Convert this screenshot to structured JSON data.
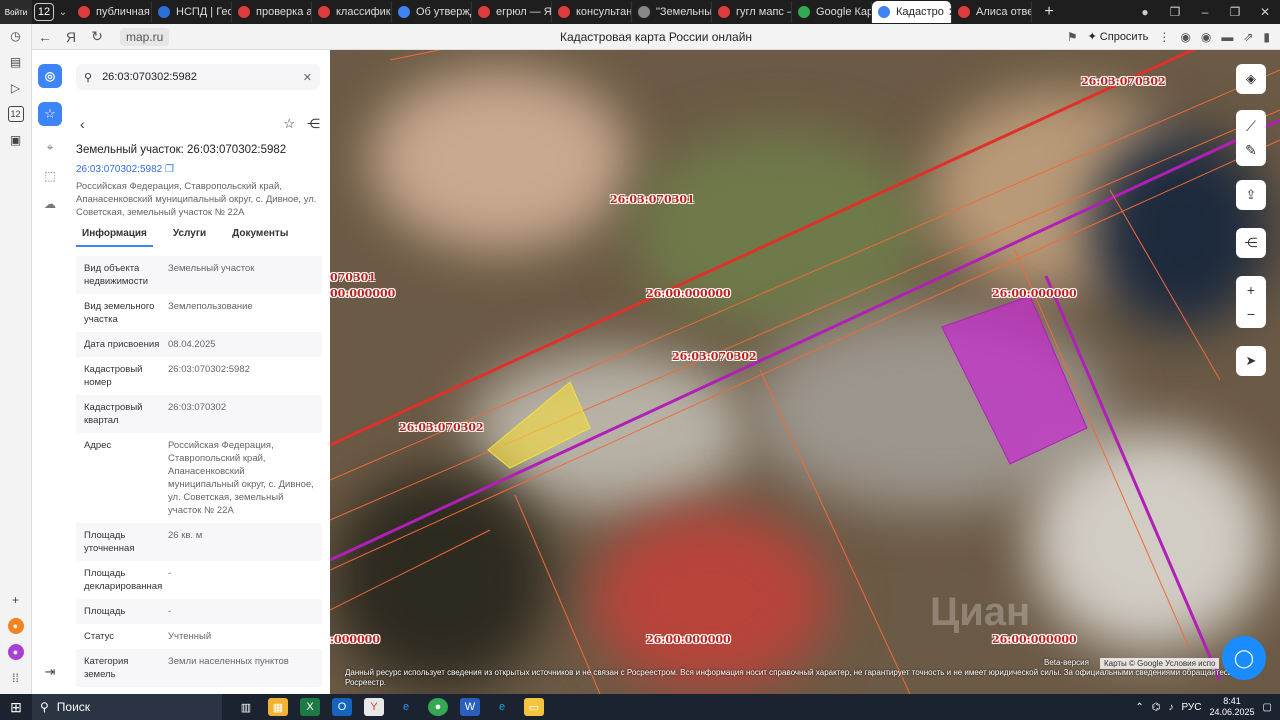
{
  "browser": {
    "tab_count": "12",
    "tabs": [
      {
        "label": "публичная к",
        "color": "#e23b3b"
      },
      {
        "label": "НСПД | Геоп",
        "color": "#2a6fdb"
      },
      {
        "label": "проверка ав",
        "color": "#e23b3b"
      },
      {
        "label": "классифика",
        "color": "#e23b3b"
      },
      {
        "label": "Об утвержд",
        "color": "#3c84f7"
      },
      {
        "label": "егрюл — Янд",
        "color": "#e23b3b"
      },
      {
        "label": "консультант",
        "color": "#e23b3b"
      },
      {
        "label": "\"Земельный",
        "color": "#888888"
      },
      {
        "label": "гугл мапс —",
        "color": "#e23b3b"
      },
      {
        "label": "Google Карт",
        "color": "#34a853"
      },
      {
        "label": "Кадастро",
        "color": "#3c84f7"
      },
      {
        "label": "Алиса отвеч",
        "color": "#e23b3b"
      }
    ],
    "url": "map.ru",
    "page_title": "Кадастровая карта России онлайн",
    "ask_label": "Спросить"
  },
  "os_sidebar": {
    "badge": "12",
    "login": "Войти"
  },
  "panel": {
    "search_value": "26:03:070302:5982",
    "title": "Земельный участок: 26:03:070302:5982",
    "link": "26:03:070302:5982",
    "address": "Российская Федерация, Ставропольский край, Апанасенковский муниципальный округ, с. Дивное, ул. Советская, земельный участок № 22А",
    "tabs": [
      "Информация",
      "Услуги",
      "Документы"
    ],
    "rows": [
      {
        "k": "Вид объекта недвижимости",
        "v": "Земельный участок"
      },
      {
        "k": "Вид земельного участка",
        "v": "Землепользование"
      },
      {
        "k": "Дата присвоения",
        "v": "08.04.2025"
      },
      {
        "k": "Кадастровый номер",
        "v": "26:03:070302:5982"
      },
      {
        "k": "Кадастровый квартал",
        "v": "26:03:070302"
      },
      {
        "k": "Адрес",
        "v": "Российская Федерация, Ставропольский край, Апанасенковский муниципальный округ, с. Дивное, ул. Советская, земельный участок № 22А"
      },
      {
        "k": "Площадь уточненная",
        "v": "26 кв. м"
      },
      {
        "k": "Площадь декларированная",
        "v": "-"
      },
      {
        "k": "Площадь",
        "v": "-"
      },
      {
        "k": "Статус",
        "v": "Учтенный"
      },
      {
        "k": "Категория земель",
        "v": "Земли населенных пунктов"
      }
    ]
  },
  "map": {
    "labels": {
      "l1": "26:03:070302",
      "l2": "26:03:070301",
      "l3": "070301",
      "l4": "00:000000",
      "l5": "26:00:000000",
      "l6": "26:00:000000",
      "l7": "26:03:070302",
      "l8": "26:03:070302",
      "l9": ":000000",
      "l10": "26:00:000000",
      "l11": "26:00:000000"
    },
    "beta": "Beta-версия",
    "credits": "Карты © Google   Условия испо",
    "disclaimer": "Данный ресурс использует сведения из открытых источников и не связан с Росреестром. Вся информация носит справочный характер, не гарантирует точность и не имеет юридической силы. За официальными сведениями обращайтесь в Росреестр.",
    "watermark": "Циан"
  },
  "taskbar": {
    "search": "Поиск",
    "lang": "РУС",
    "time": "8:41",
    "date": "24.06.2025"
  }
}
